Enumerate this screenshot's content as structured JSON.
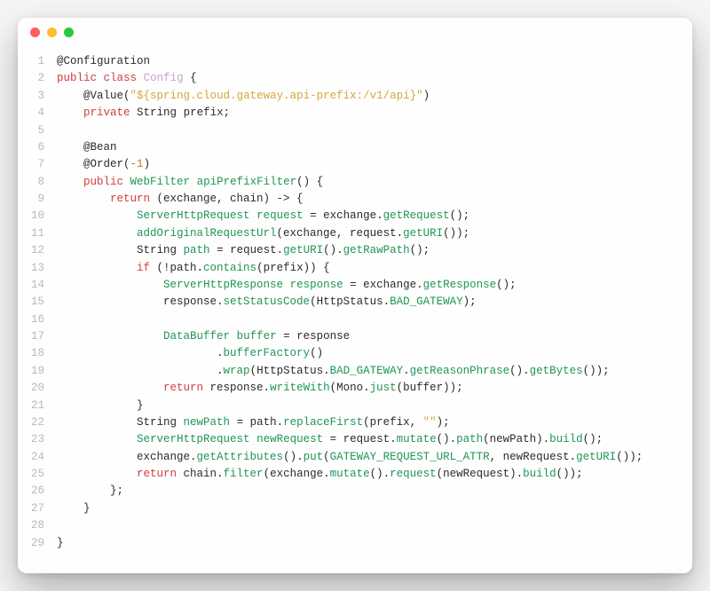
{
  "window": {
    "traffic": [
      "close",
      "minimize",
      "maximize"
    ]
  },
  "editor": {
    "language": "java",
    "lines": [
      {
        "n": 1,
        "indent": 0,
        "tokens": [
          {
            "t": "@Configuration",
            "c": "tok-ann"
          }
        ]
      },
      {
        "n": 2,
        "indent": 0,
        "tokens": [
          {
            "t": "public",
            "c": "tok-kw"
          },
          {
            "t": " "
          },
          {
            "t": "class",
            "c": "tok-kw"
          },
          {
            "t": " "
          },
          {
            "t": "Config",
            "c": "tok-classname"
          },
          {
            "t": " {"
          }
        ]
      },
      {
        "n": 3,
        "indent": 1,
        "tokens": [
          {
            "t": "@Value",
            "c": "tok-ann"
          },
          {
            "t": "("
          },
          {
            "t": "\"${spring.cloud.gateway.api-prefix:/v1/api}\"",
            "c": "tok-str"
          },
          {
            "t": ")"
          }
        ]
      },
      {
        "n": 4,
        "indent": 1,
        "tokens": [
          {
            "t": "private",
            "c": "tok-kw"
          },
          {
            "t": " "
          },
          {
            "t": "String",
            "c": "tok-var"
          },
          {
            "t": " prefix;"
          }
        ]
      },
      {
        "n": 5,
        "indent": 0,
        "tokens": []
      },
      {
        "n": 6,
        "indent": 1,
        "tokens": [
          {
            "t": "@Bean",
            "c": "tok-ann"
          }
        ]
      },
      {
        "n": 7,
        "indent": 1,
        "tokens": [
          {
            "t": "@Order",
            "c": "tok-ann"
          },
          {
            "t": "("
          },
          {
            "t": "-1",
            "c": "tok-num"
          },
          {
            "t": ")"
          }
        ]
      },
      {
        "n": 8,
        "indent": 1,
        "tokens": [
          {
            "t": "public",
            "c": "tok-kw"
          },
          {
            "t": " "
          },
          {
            "t": "WebFilter",
            "c": "tok-type"
          },
          {
            "t": " "
          },
          {
            "t": "apiPrefixFilter",
            "c": "tok-fn"
          },
          {
            "t": "() {"
          }
        ]
      },
      {
        "n": 9,
        "indent": 2,
        "tokens": [
          {
            "t": "return",
            "c": "tok-kw"
          },
          {
            "t": " (exchange, chain) -> {"
          }
        ]
      },
      {
        "n": 10,
        "indent": 3,
        "tokens": [
          {
            "t": "ServerHttpRequest",
            "c": "tok-type"
          },
          {
            "t": " "
          },
          {
            "t": "request",
            "c": "tok-id"
          },
          {
            "t": " = exchange."
          },
          {
            "t": "getRequest",
            "c": "tok-fn"
          },
          {
            "t": "();"
          }
        ]
      },
      {
        "n": 11,
        "indent": 3,
        "tokens": [
          {
            "t": "addOriginalRequestUrl",
            "c": "tok-fn"
          },
          {
            "t": "(exchange, request."
          },
          {
            "t": "getURI",
            "c": "tok-fn"
          },
          {
            "t": "());"
          }
        ]
      },
      {
        "n": 12,
        "indent": 3,
        "tokens": [
          {
            "t": "String",
            "c": "tok-var"
          },
          {
            "t": " "
          },
          {
            "t": "path",
            "c": "tok-id"
          },
          {
            "t": " = request."
          },
          {
            "t": "getURI",
            "c": "tok-fn"
          },
          {
            "t": "()."
          },
          {
            "t": "getRawPath",
            "c": "tok-fn"
          },
          {
            "t": "();"
          }
        ]
      },
      {
        "n": 13,
        "indent": 3,
        "tokens": [
          {
            "t": "if",
            "c": "tok-kw"
          },
          {
            "t": " (!path."
          },
          {
            "t": "contains",
            "c": "tok-fn"
          },
          {
            "t": "(prefix)) {"
          }
        ]
      },
      {
        "n": 14,
        "indent": 4,
        "tokens": [
          {
            "t": "ServerHttpResponse",
            "c": "tok-type"
          },
          {
            "t": " "
          },
          {
            "t": "response",
            "c": "tok-id"
          },
          {
            "t": " = exchange."
          },
          {
            "t": "getResponse",
            "c": "tok-fn"
          },
          {
            "t": "();"
          }
        ]
      },
      {
        "n": 15,
        "indent": 4,
        "tokens": [
          {
            "t": "response."
          },
          {
            "t": "setStatusCode",
            "c": "tok-fn"
          },
          {
            "t": "(HttpStatus."
          },
          {
            "t": "BAD_GATEWAY",
            "c": "tok-const"
          },
          {
            "t": ");"
          }
        ]
      },
      {
        "n": 16,
        "indent": 0,
        "tokens": []
      },
      {
        "n": 17,
        "indent": 4,
        "tokens": [
          {
            "t": "DataBuffer",
            "c": "tok-type"
          },
          {
            "t": " "
          },
          {
            "t": "buffer",
            "c": "tok-id"
          },
          {
            "t": " = response"
          }
        ]
      },
      {
        "n": 18,
        "indent": 6,
        "tokens": [
          {
            "t": "."
          },
          {
            "t": "bufferFactory",
            "c": "tok-fn"
          },
          {
            "t": "()"
          }
        ]
      },
      {
        "n": 19,
        "indent": 6,
        "tokens": [
          {
            "t": "."
          },
          {
            "t": "wrap",
            "c": "tok-fn"
          },
          {
            "t": "(HttpStatus."
          },
          {
            "t": "BAD_GATEWAY",
            "c": "tok-const"
          },
          {
            "t": "."
          },
          {
            "t": "getReasonPhrase",
            "c": "tok-fn"
          },
          {
            "t": "()."
          },
          {
            "t": "getBytes",
            "c": "tok-fn"
          },
          {
            "t": "());"
          }
        ]
      },
      {
        "n": 20,
        "indent": 4,
        "tokens": [
          {
            "t": "return",
            "c": "tok-kw"
          },
          {
            "t": " response."
          },
          {
            "t": "writeWith",
            "c": "tok-fn"
          },
          {
            "t": "(Mono."
          },
          {
            "t": "just",
            "c": "tok-fn"
          },
          {
            "t": "(buffer));"
          }
        ]
      },
      {
        "n": 21,
        "indent": 3,
        "tokens": [
          {
            "t": "}"
          }
        ]
      },
      {
        "n": 22,
        "indent": 3,
        "tokens": [
          {
            "t": "String",
            "c": "tok-var"
          },
          {
            "t": " "
          },
          {
            "t": "newPath",
            "c": "tok-id"
          },
          {
            "t": " = path."
          },
          {
            "t": "replaceFirst",
            "c": "tok-fn"
          },
          {
            "t": "(prefix, "
          },
          {
            "t": "\"\"",
            "c": "tok-str"
          },
          {
            "t": ");"
          }
        ]
      },
      {
        "n": 23,
        "indent": 3,
        "tokens": [
          {
            "t": "ServerHttpRequest",
            "c": "tok-type"
          },
          {
            "t": " "
          },
          {
            "t": "newRequest",
            "c": "tok-id"
          },
          {
            "t": " = request."
          },
          {
            "t": "mutate",
            "c": "tok-fn"
          },
          {
            "t": "()."
          },
          {
            "t": "path",
            "c": "tok-fn"
          },
          {
            "t": "(newPath)."
          },
          {
            "t": "build",
            "c": "tok-fn"
          },
          {
            "t": "();"
          }
        ]
      },
      {
        "n": 24,
        "indent": 3,
        "tokens": [
          {
            "t": "exchange."
          },
          {
            "t": "getAttributes",
            "c": "tok-fn"
          },
          {
            "t": "()."
          },
          {
            "t": "put",
            "c": "tok-fn"
          },
          {
            "t": "("
          },
          {
            "t": "GATEWAY_REQUEST_URL_ATTR",
            "c": "tok-const"
          },
          {
            "t": ", newRequest."
          },
          {
            "t": "getURI",
            "c": "tok-fn"
          },
          {
            "t": "());"
          }
        ]
      },
      {
        "n": 25,
        "indent": 3,
        "tokens": [
          {
            "t": "return",
            "c": "tok-kw"
          },
          {
            "t": " chain."
          },
          {
            "t": "filter",
            "c": "tok-fn"
          },
          {
            "t": "(exchange."
          },
          {
            "t": "mutate",
            "c": "tok-fn"
          },
          {
            "t": "()."
          },
          {
            "t": "request",
            "c": "tok-fn"
          },
          {
            "t": "(newRequest)."
          },
          {
            "t": "build",
            "c": "tok-fn"
          },
          {
            "t": "());"
          }
        ]
      },
      {
        "n": 26,
        "indent": 2,
        "tokens": [
          {
            "t": "};"
          }
        ]
      },
      {
        "n": 27,
        "indent": 1,
        "tokens": [
          {
            "t": "}"
          }
        ]
      },
      {
        "n": 28,
        "indent": 0,
        "tokens": []
      },
      {
        "n": 29,
        "indent": 0,
        "tokens": [
          {
            "t": "}"
          }
        ]
      }
    ]
  }
}
